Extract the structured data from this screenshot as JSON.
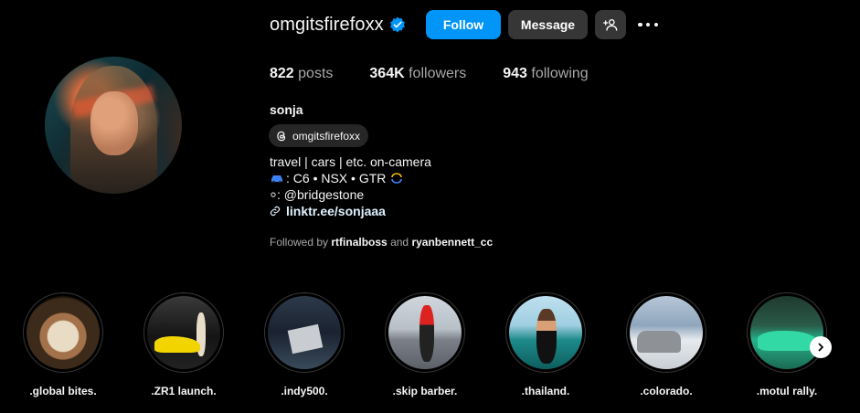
{
  "profile": {
    "username": "omgitsfirefoxx",
    "verified": true,
    "full_name": "sonja",
    "threads_handle": "omgitsfirefoxx",
    "bio": {
      "line1": "travel | cars | etc. on-camera",
      "line2": ": C6 • NSX • GTR",
      "line3": "⸰: @bridgestone",
      "link": "linktr.ee/sonjaaa"
    }
  },
  "actions": {
    "follow": "Follow",
    "message": "Message"
  },
  "stats": {
    "posts_count": "822",
    "posts_label": "posts",
    "followers_count": "364K",
    "followers_label": "followers",
    "following_count": "943",
    "following_label": "following"
  },
  "followed_by": {
    "prefix": "Followed by",
    "user1": "rtfinalboss",
    "conj": "and",
    "user2": "ryanbennett_cc"
  },
  "highlights": [
    {
      "label": ".global bites."
    },
    {
      "label": ".ZR1 launch."
    },
    {
      "label": ".indy500."
    },
    {
      "label": ".skip barber."
    },
    {
      "label": ".thailand."
    },
    {
      "label": ".colorado."
    },
    {
      "label": ".motul rally."
    }
  ],
  "colors": {
    "accent": "#0095f6",
    "button_secondary": "#363636",
    "background": "#000000"
  },
  "icons": [
    "verified-badge-icon",
    "add-person-icon",
    "more-options-icon",
    "threads-icon",
    "car-icon",
    "link-icon",
    "chevron-right-icon"
  ]
}
